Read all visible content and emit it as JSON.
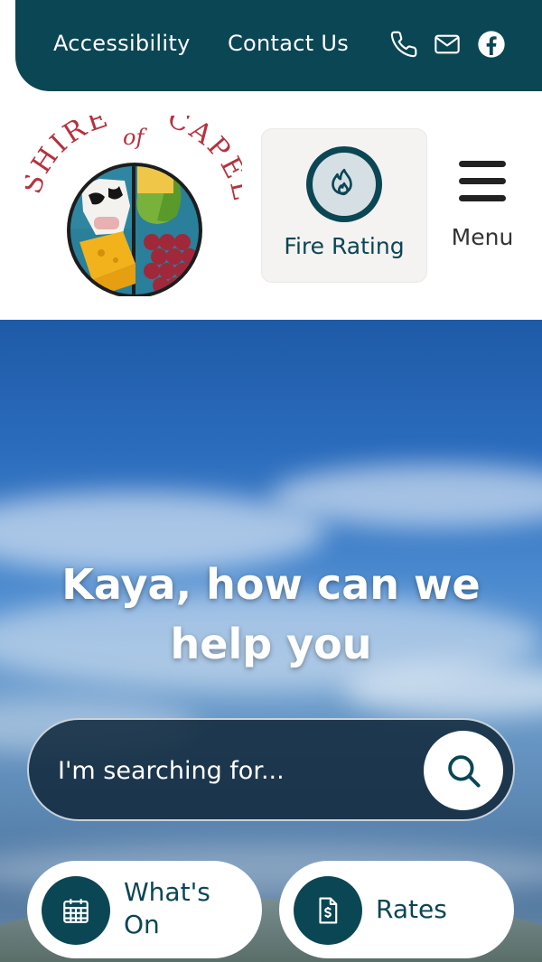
{
  "topbar": {
    "accessibility": "Accessibility",
    "contact": "Contact Us",
    "icons": [
      "phone-icon",
      "mail-icon",
      "facebook-icon"
    ]
  },
  "header": {
    "logo": {
      "top_text": "SHIRE",
      "middle_text": "of",
      "right_text": "CAPEL"
    },
    "fire_rating_label": "Fire Rating",
    "menu_label": "Menu"
  },
  "hero": {
    "headline_line1": "Kaya, how can we",
    "headline_line2": "help you",
    "search_placeholder": "I'm searching for...",
    "quick_links": [
      {
        "label": "What's On",
        "icon": "calendar-icon"
      },
      {
        "label": "Rates",
        "icon": "rates-document-icon"
      }
    ]
  },
  "colors": {
    "brand_teal": "#0b4654",
    "logo_red": "#b5323f",
    "white": "#ffffff"
  }
}
